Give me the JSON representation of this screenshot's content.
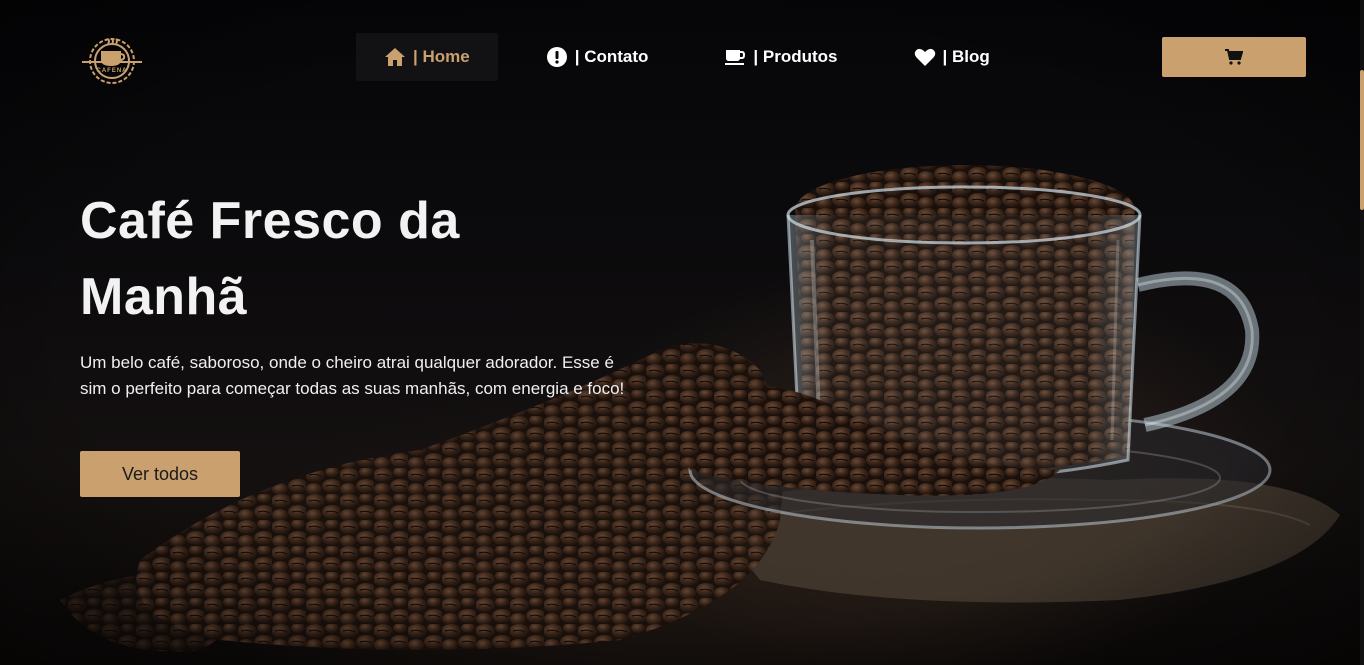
{
  "brand": {
    "logo_text": "CAFENA",
    "logo_icon": "coffee-cup-gear-icon"
  },
  "nav": {
    "items": [
      {
        "label": "| Home",
        "icon": "house-icon",
        "active": true
      },
      {
        "label": "| Contato",
        "icon": "exclamation-circle-icon",
        "active": false
      },
      {
        "label": "| Produtos",
        "icon": "coffee-mug-icon",
        "active": false
      },
      {
        "label": "| Blog",
        "icon": "heart-icon",
        "active": false
      }
    ],
    "cart_icon": "shopping-cart-icon"
  },
  "hero": {
    "title": "Café Fresco da Manhã",
    "description": "Um belo café, saboroso, onde o cheiro atrai qualquer adorador. Esse é sim o perfeito para começar todas as suas manhãs, com energia e foco!",
    "cta_label": "Ver todos",
    "image": "coffee-beans-glass-cup-image"
  },
  "colors": {
    "accent": "#c9a06e",
    "background": "#07070a",
    "text": "#ffffff",
    "active_nav_bg": "#121214"
  }
}
